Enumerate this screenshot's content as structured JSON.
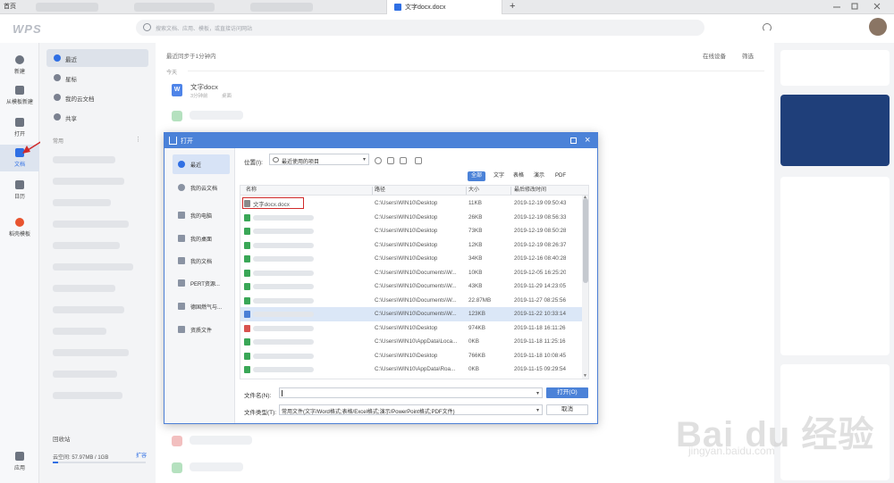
{
  "tabs": {
    "home": "首页",
    "active_doc": "文字docx.docx",
    "new_tab": "+"
  },
  "header": {
    "logo": "WPS",
    "search_placeholder": "搜索文档、应用、模板，或直接访问网站"
  },
  "rail": [
    {
      "label": "新建",
      "icon": "plus-circle-icon"
    },
    {
      "label": "从模板新建",
      "icon": "template-icon"
    },
    {
      "label": "打开",
      "icon": "folder-icon"
    },
    {
      "label": "文档",
      "icon": "document-icon",
      "active": true
    },
    {
      "label": "日历",
      "icon": "calendar-icon"
    },
    {
      "label": "稻壳模板",
      "icon": "docer-icon"
    },
    {
      "label": "应用",
      "icon": "apps-icon"
    }
  ],
  "sidebar": {
    "items": [
      {
        "label": "最近",
        "icon": "clock-icon",
        "active": true
      },
      {
        "label": "星标",
        "icon": "star-icon"
      },
      {
        "label": "我的云文档",
        "icon": "cloud-icon"
      },
      {
        "label": "共享",
        "icon": "share-icon"
      }
    ],
    "section_label": "常用",
    "section_more": "⋮",
    "recycle": "回收站",
    "quota": "云空间: 57.97MB / 1GB",
    "quota_fraction": 0.06,
    "expand": "扩容"
  },
  "main": {
    "sync_status": "最近同步于1分钟内",
    "online_devices": "在线设备",
    "filter": "筛选",
    "today_label": "今天",
    "recent_file": {
      "name": "文字docx",
      "time": "3分钟前",
      "location": "桌面"
    }
  },
  "dialog": {
    "title": "打开",
    "left_items": [
      {
        "label": "最近",
        "active": true
      },
      {
        "label": "我的云文档"
      },
      {
        "label": "我的电脑"
      },
      {
        "label": "我的桌面"
      },
      {
        "label": "我的文档"
      },
      {
        "label": "PERT资源..."
      },
      {
        "label": "德国燃气与..."
      },
      {
        "label": "资质文件"
      }
    ],
    "location_label": "位置(I):",
    "location_value": "最近使用的项目",
    "filter_tabs": [
      "全部",
      "文字",
      "表格",
      "演示",
      "PDF"
    ],
    "columns": {
      "name": "名称",
      "path": "路径",
      "size": "大小",
      "modified": "最后修改时间"
    },
    "rows": [
      {
        "name": "文字docx.docx",
        "path": "C:\\Users\\WIN10\\Desktop",
        "size": "11KB",
        "modified": "2019-12-19 09:50:43",
        "color": "#8a8a8a"
      },
      {
        "name": "",
        "path": "C:\\Users\\WIN10\\Desktop",
        "size": "26KB",
        "modified": "2019-12-19 08:56:33",
        "color": "#3aa757"
      },
      {
        "name": "",
        "path": "C:\\Users\\WIN10\\Desktop",
        "size": "73KB",
        "modified": "2019-12-19 08:50:28",
        "color": "#3aa757"
      },
      {
        "name": "",
        "path": "C:\\Users\\WIN10\\Desktop",
        "size": "12KB",
        "modified": "2019-12-19 08:26:37",
        "color": "#3aa757"
      },
      {
        "name": "",
        "path": "C:\\Users\\WIN10\\Desktop",
        "size": "34KB",
        "modified": "2019-12-16 08:40:28",
        "color": "#3aa757"
      },
      {
        "name": "",
        "path": "C:\\Users\\WIN10\\Documents\\W...",
        "size": "10KB",
        "modified": "2019-12-05 16:25:20",
        "color": "#3aa757"
      },
      {
        "name": "",
        "path": "C:\\Users\\WIN10\\Documents\\W...",
        "size": "43KB",
        "modified": "2019-11-29 14:23:05",
        "color": "#3aa757"
      },
      {
        "name": "",
        "path": "C:\\Users\\WIN10\\Documents\\W...",
        "size": "22.87MB",
        "modified": "2019-11-27 08:25:56",
        "color": "#3aa757"
      },
      {
        "name": "",
        "path": "C:\\Users\\WIN10\\Documents\\W...",
        "size": "123KB",
        "modified": "2019-11-22 10:33:14",
        "color": "#4a7fd6",
        "selected": true
      },
      {
        "name": "",
        "path": "C:\\Users\\WIN10\\Desktop",
        "size": "974KB",
        "modified": "2019-11-18 16:11:26",
        "color": "#d9534f"
      },
      {
        "name": "",
        "path": "C:\\Users\\WIN10\\AppData\\Loca...",
        "size": "0KB",
        "modified": "2019-11-18 11:25:16",
        "color": "#3aa757"
      },
      {
        "name": "",
        "path": "C:\\Users\\WIN10\\Desktop",
        "size": "766KB",
        "modified": "2019-11-18 10:08:45",
        "color": "#3aa757"
      },
      {
        "name": "",
        "path": "C:\\Users\\WIN10\\AppData\\Roa...",
        "size": "0KB",
        "modified": "2019-11-15 09:29:54",
        "color": "#3aa757"
      }
    ],
    "filename_label": "文件名(N):",
    "filename_value": "",
    "filetype_label": "文件类型(T):",
    "filetype_value": "常用文件(文字/Word格式;表格/Excel格式;演示/PowerPoint格式;PDF文件)",
    "open_button": "打开(O)",
    "cancel_button": "取消"
  },
  "watermark": {
    "big": "Bai du 经验",
    "small": "jingyan.baidu.com"
  },
  "colors": {
    "accent": "#4b82d8",
    "brand_blue": "#2f6fe4",
    "highlight_red": "#d02a2a"
  }
}
